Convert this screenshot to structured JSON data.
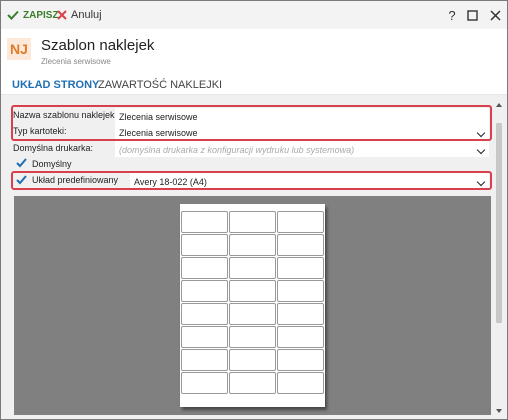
{
  "toolbar": {
    "save_label": "ZAPISZ",
    "cancel_label": "Anuluj"
  },
  "header": {
    "badge": "NJ",
    "title": "Szablon naklejek",
    "subtitle": "Zlecenia serwisowe"
  },
  "tabs": [
    {
      "label": "UKŁAD STRONY",
      "active": true
    },
    {
      "label": "ZAWARTOŚĆ NAKLEJKI",
      "active": false
    }
  ],
  "form": {
    "name_label": "Nazwa szablonu naklejek:",
    "name_value": "Zlecenia serwisowe",
    "type_label": "Typ kartoteki:",
    "type_value": "Zlecenia serwisowe",
    "printer_label": "Domyślna drukarka:",
    "printer_placeholder": "(domyślna drukarka z konfiguracji wydruku lub systemowa)",
    "default_label": "Domyślny",
    "default_checked": true,
    "layout_label": "Układ predefiniowany",
    "layout_checked": true,
    "layout_value": "Avery 18-022 (A4)"
  },
  "preview": {
    "columns": 3,
    "rows": 8
  },
  "colors": {
    "accent": "#1f6fb2",
    "highlight": "#d9404d",
    "save": "#3a7d2a",
    "cancel": "#d9404d",
    "badge_bg": "#fde9d9",
    "badge_fg": "#e07b2a"
  },
  "icons": {
    "save": "check-icon",
    "cancel": "x-icon",
    "help": "question-icon",
    "maximize": "maximize-icon",
    "close": "close-icon"
  }
}
